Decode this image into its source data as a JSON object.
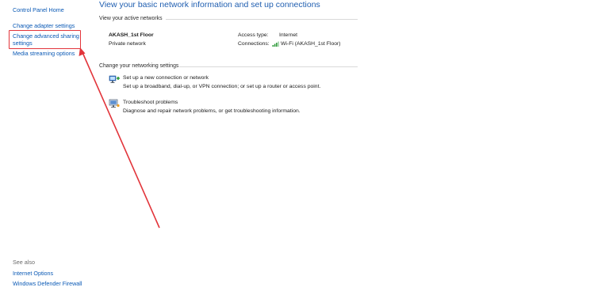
{
  "sidebar": {
    "home": "Control Panel Home",
    "items": [
      "Change adapter settings",
      "Change advanced sharing",
      "settings",
      "Media streaming options"
    ],
    "see_also_label": "See also",
    "see_also_items": [
      "Internet Options",
      "Windows Defender Firewall"
    ]
  },
  "main": {
    "title": "View your basic network information and set up connections",
    "active_networks_label": "View your active networks",
    "network": {
      "name": "AKASH_1st Floor",
      "type": "Private network",
      "access_type_label": "Access type:",
      "access_type_value": "Internet",
      "connections_label": "Connections:",
      "connections_value": "Wi-Fi (AKASH_1st Floor)"
    },
    "change_settings_label": "Change your networking settings",
    "actions": [
      {
        "title": "Set up a new connection or network",
        "description": "Set up a broadband, dial-up, or VPN connection; or set up a router or access point.",
        "icon": "network-setup-icon"
      },
      {
        "title": "Troubleshoot problems",
        "description": "Diagnose and repair network problems, or get troubleshooting information.",
        "icon": "troubleshoot-icon"
      }
    ]
  },
  "annotation": {
    "color": "#e2353b"
  },
  "colors": {
    "link": "#0a59b5",
    "title": "#1f5eb0"
  }
}
